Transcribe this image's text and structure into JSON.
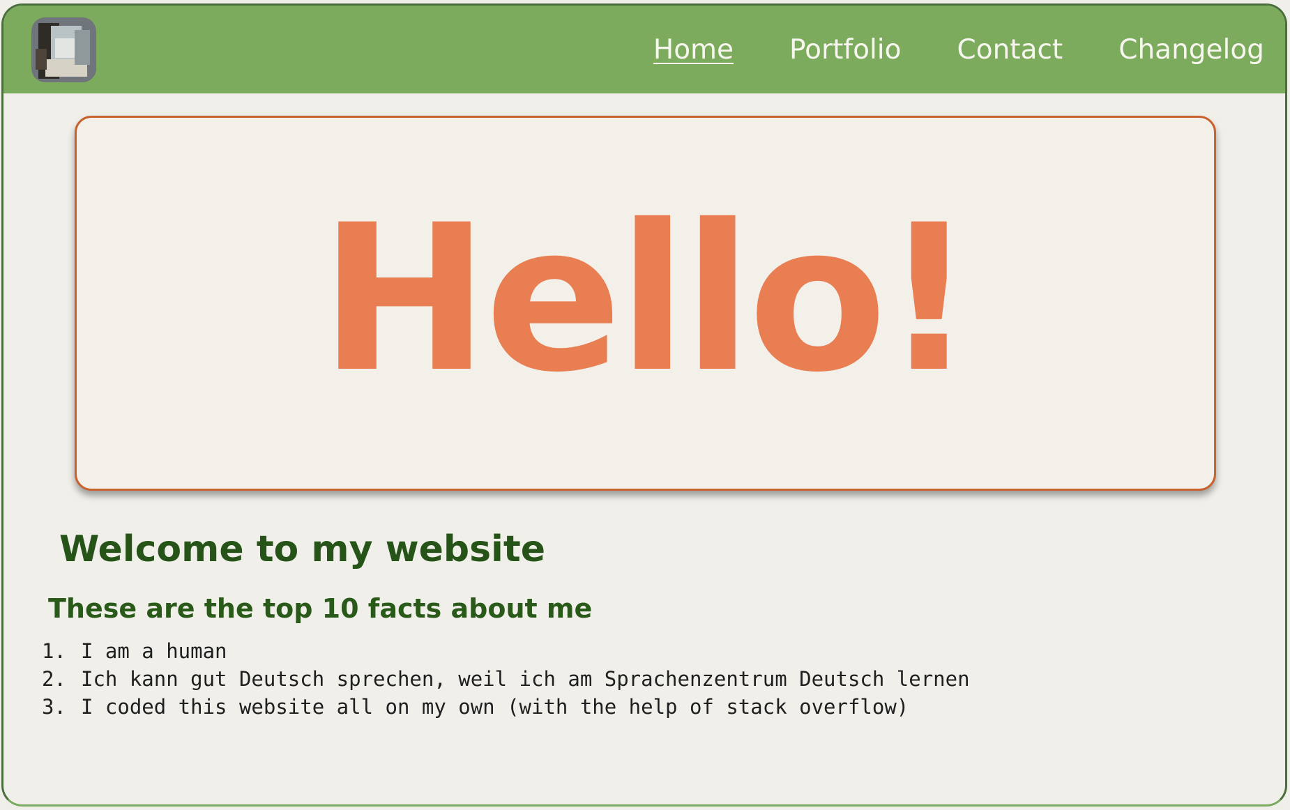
{
  "nav": {
    "logo_icon": "profile-photo-icon",
    "links": [
      {
        "label": "Home",
        "active": true
      },
      {
        "label": "Portfolio",
        "active": false
      },
      {
        "label": "Contact",
        "active": false
      },
      {
        "label": "Changelog",
        "active": false
      }
    ],
    "background_color": "#7dab5e"
  },
  "hero": {
    "title": "Hello!",
    "title_color": "#e87e52",
    "border_color": "#c8622f"
  },
  "main": {
    "welcome_heading": "Welcome to my website",
    "facts_heading": "These are the top 10 facts about me",
    "facts": [
      {
        "num": "1.",
        "text": "I am a human"
      },
      {
        "num": "2.",
        "text": "Ich kann gut Deutsch sprechen, weil ich am Sprachenzentrum Deutsch lernen"
      },
      {
        "num": "3.",
        "text": "I coded this website all on my own (with the help of stack overflow)"
      }
    ],
    "heading_color": "#265318"
  }
}
